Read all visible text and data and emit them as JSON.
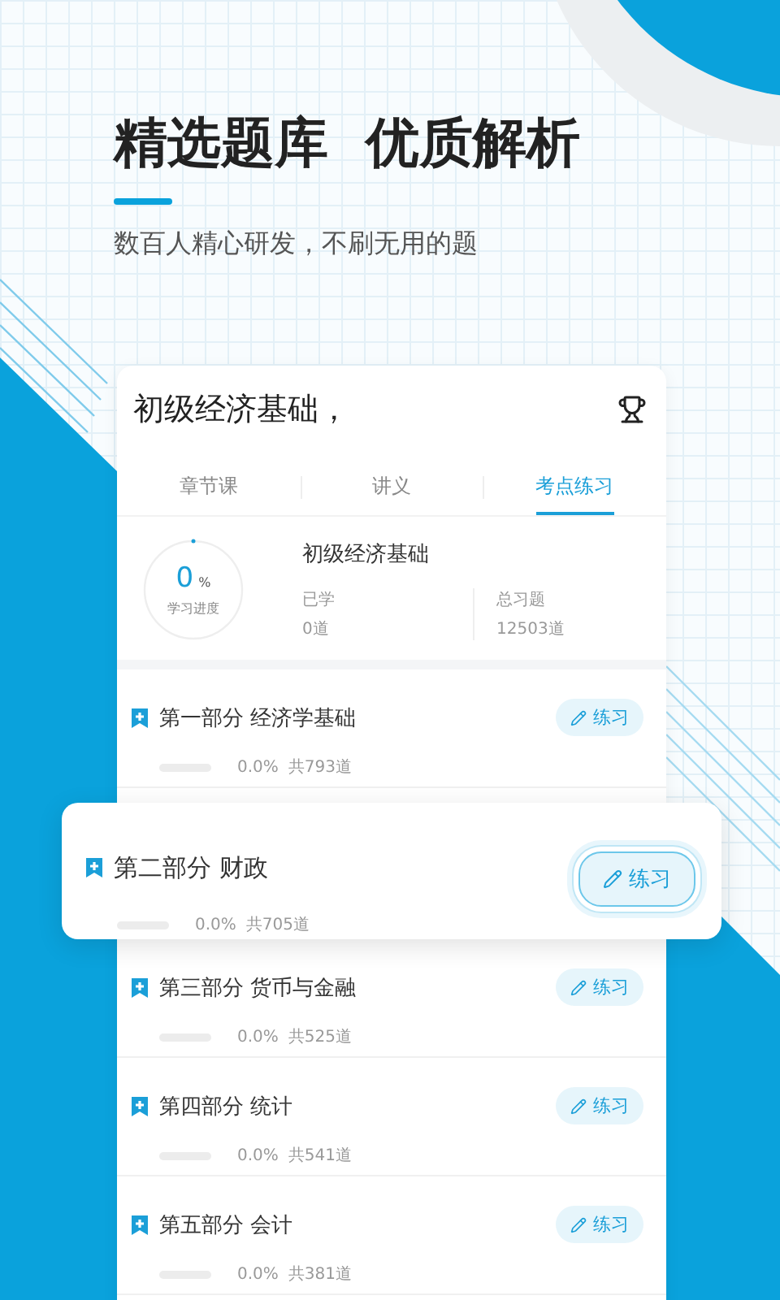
{
  "headline": "精选题库  优质解析",
  "subtitle": "数百人精心研发，不刷无用的题",
  "course": {
    "title": "初级经济基础，"
  },
  "tabs": [
    {
      "label": "章节课",
      "selected": false
    },
    {
      "label": "讲义",
      "selected": false
    },
    {
      "label": "考点练习",
      "selected": true
    }
  ],
  "summary": {
    "progress": "0",
    "percent_sign": "%",
    "progress_label": "学习进度",
    "level": 0,
    "name": "初级经济基础",
    "stats": [
      {
        "label": "已学",
        "value": "0道"
      },
      {
        "label": "总习题",
        "value": "12503道"
      }
    ]
  },
  "sections": [
    {
      "title": "第一部分 经济学基础",
      "level": 0,
      "percent": "0.0%",
      "count": "共793道",
      "button": "练习",
      "highlighted": false
    },
    {
      "title": "第二部分 财政",
      "level": 0,
      "percent": "0.0%",
      "count": "共705道",
      "button": "练习",
      "highlighted": true
    },
    {
      "title": "第三部分 货币与金融",
      "level": 0,
      "percent": "0.0%",
      "count": "共525道",
      "button": "练习",
      "highlighted": false
    },
    {
      "title": "第四部分 统计",
      "level": 0,
      "percent": "0.0%",
      "count": "共541道",
      "button": "练习",
      "highlighted": false
    },
    {
      "title": "第五部分 会计",
      "level": 0,
      "percent": "0.0%",
      "count": "共381道",
      "button": "练习",
      "highlighted": false
    }
  ]
}
